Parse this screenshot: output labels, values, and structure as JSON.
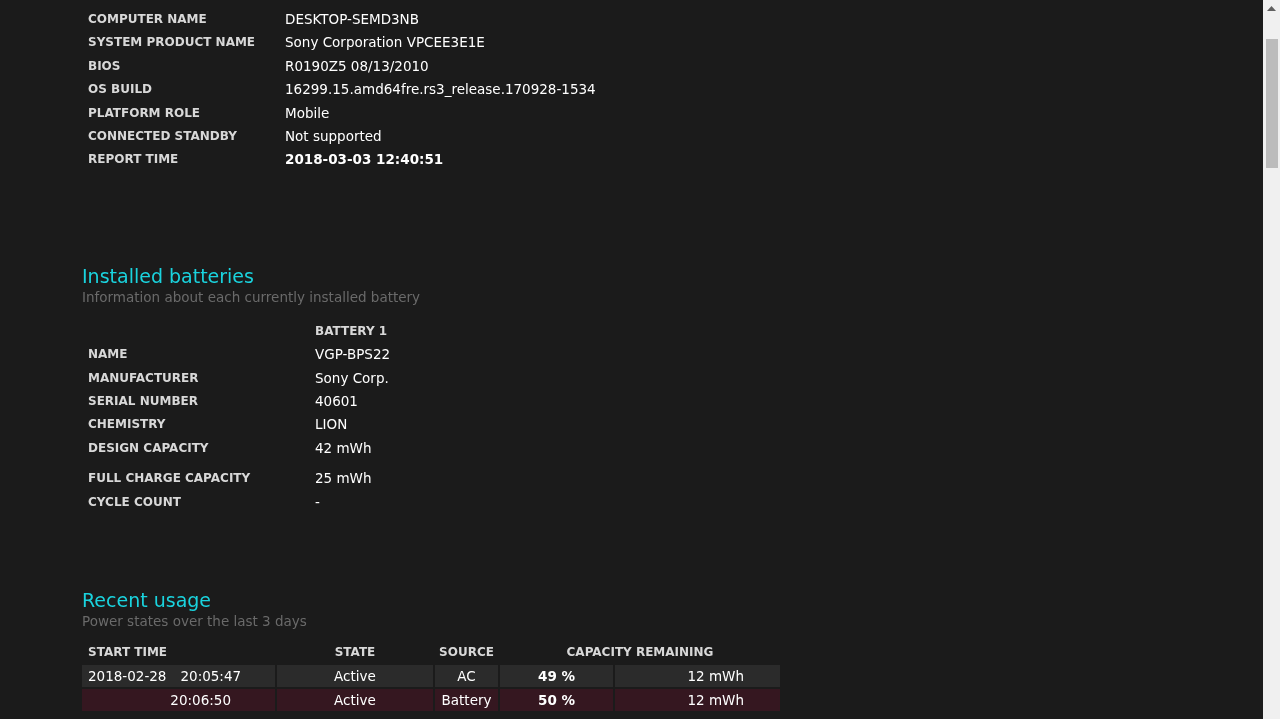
{
  "system_info": [
    {
      "label": "COMPUTER NAME",
      "value": "DESKTOP-SEMD3NB"
    },
    {
      "label": "SYSTEM PRODUCT NAME",
      "value": "Sony Corporation VPCEE3E1E"
    },
    {
      "label": "BIOS",
      "value": "R0190Z5 08/13/2010"
    },
    {
      "label": "OS BUILD",
      "value": "16299.15.amd64fre.rs3_release.170928-1534"
    },
    {
      "label": "PLATFORM ROLE",
      "value": "Mobile"
    },
    {
      "label": "CONNECTED STANDBY",
      "value": "Not supported"
    },
    {
      "label": "REPORT TIME",
      "value": "2018-03-03  12:40:51"
    }
  ],
  "installed_batteries": {
    "title": "Installed batteries",
    "subtitle": "Information about each currently installed battery",
    "column_header": "BATTERY 1",
    "rows": [
      {
        "label": "NAME",
        "value": "VGP-BPS22"
      },
      {
        "label": "MANUFACTURER",
        "value": "Sony Corp."
      },
      {
        "label": "SERIAL NUMBER",
        "value": "40601"
      },
      {
        "label": "CHEMISTRY",
        "value": "LION"
      },
      {
        "label": "DESIGN CAPACITY",
        "value": "42 mWh"
      },
      {
        "label": "FULL CHARGE CAPACITY",
        "value": "25 mWh"
      },
      {
        "label": "CYCLE COUNT",
        "value": "-"
      }
    ]
  },
  "recent_usage": {
    "title": "Recent usage",
    "subtitle": "Power states over the last 3 days",
    "columns": [
      "START TIME",
      "STATE",
      "SOURCE",
      "CAPACITY REMAINING"
    ],
    "rows": [
      {
        "kind": "ac",
        "date": "2018-02-28",
        "time": "20:05:47",
        "state": "Active",
        "source": "AC",
        "percent": "49 %",
        "capacity": "12 mWh"
      },
      {
        "kind": "battery",
        "time": "20:06:50",
        "state": "Active",
        "source": "Battery",
        "percent": "50 %",
        "capacity": "12 mWh"
      }
    ]
  }
}
